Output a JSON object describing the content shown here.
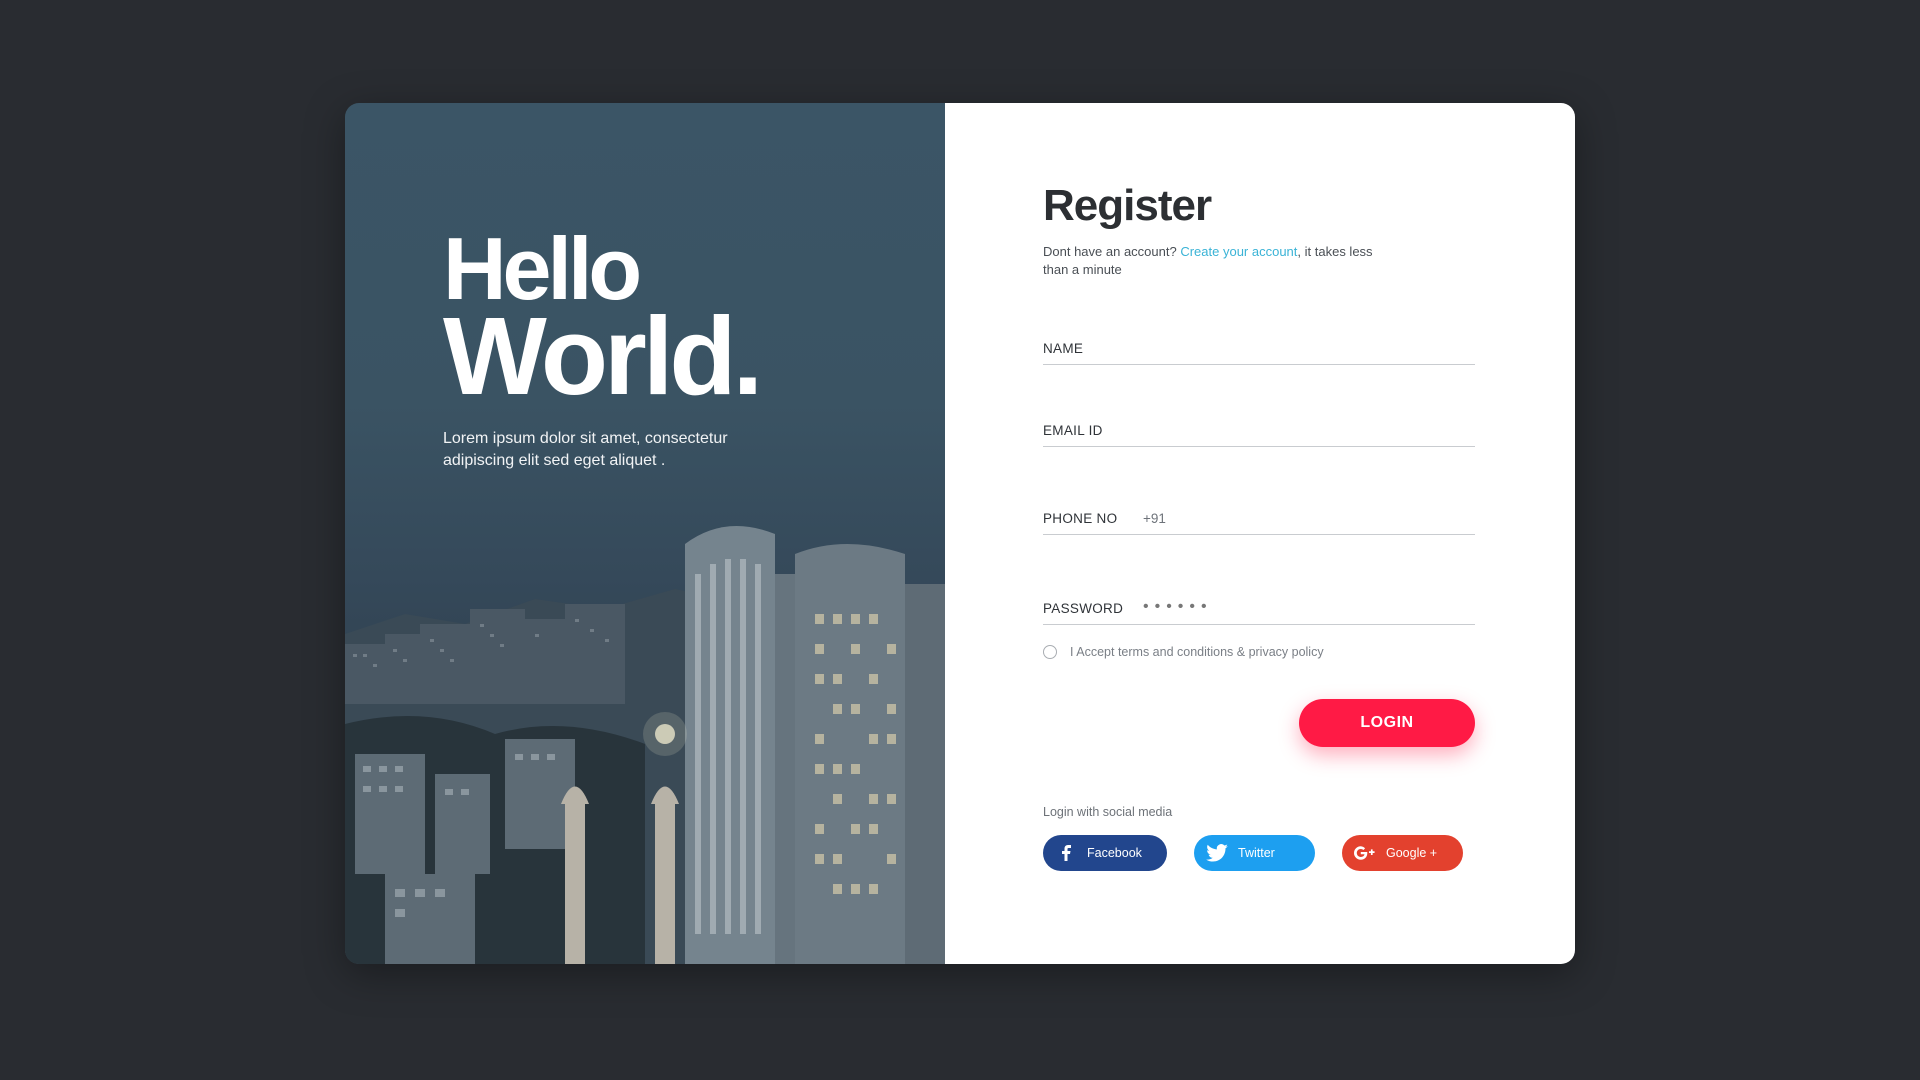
{
  "hero": {
    "title_line1": "Hello",
    "title_line2": "World.",
    "subtitle": "Lorem ipsum dolor sit amet, consectetur adipiscing elit sed eget aliquet ."
  },
  "form": {
    "title": "Register",
    "subtitle_prefix": "Dont have an account? ",
    "subtitle_link": "Create your account",
    "subtitle_suffix": ", it takes less than a minute",
    "fields": {
      "name": {
        "label": "NAME",
        "value": ""
      },
      "email": {
        "label": "EMAIL ID",
        "value": ""
      },
      "phone": {
        "label": "PHONE NO",
        "value": "+91"
      },
      "password": {
        "label": "PASSWORD",
        "value": "••••••"
      }
    },
    "terms_label": "I Accept terms and conditions & privacy policy",
    "login_label": "LOGIN",
    "social_label": "Login with social media",
    "social": {
      "facebook": "Facebook",
      "twitter": "Twitter",
      "google": "Google +"
    }
  },
  "colors": {
    "accent": "#ff1a45",
    "link": "#3ab3d6",
    "facebook": "#22468d",
    "twitter": "#1d9ff0",
    "google": "#e3412e",
    "background": "#292c31"
  }
}
